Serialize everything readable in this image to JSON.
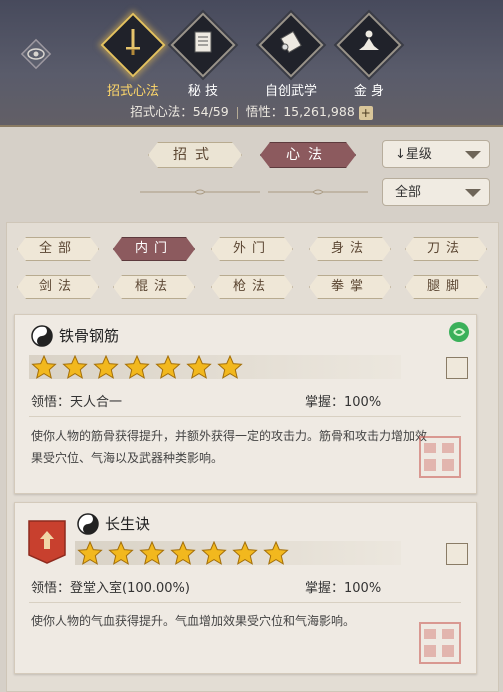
{
  "tabs": [
    {
      "label": "招式心法",
      "icon": "sword-icon",
      "active": true
    },
    {
      "label": "秘 技",
      "icon": "book-icon",
      "active": false
    },
    {
      "label": "自创武学",
      "icon": "scroll-icon",
      "active": false
    },
    {
      "label": "金 身",
      "icon": "meditation-icon",
      "active": false
    }
  ],
  "stats": {
    "skills": "招式心法：54/59",
    "wisdom": "悟性：15,261,988",
    "plus": "+"
  },
  "segments": {
    "moves": "招式",
    "mind": "心法"
  },
  "dropdowns": {
    "sort": "↓星级",
    "filter": "全部"
  },
  "categories": [
    "全部",
    "内门",
    "外门",
    "身法",
    "刀法",
    "剑法",
    "棍法",
    "枪法",
    "拳掌",
    "腿脚"
  ],
  "skills": [
    {
      "name": "铁骨钢筋",
      "stars": 7,
      "insight": "领悟：天人合一",
      "mastery": "掌握：100%",
      "desc": "使你人物的筋骨获得提升，并额外获得一定的攻击力。筋骨和攻击力增加效果受穴位、气海以及武器种类影响。"
    },
    {
      "name": "长生诀",
      "stars": 7,
      "insight": "领悟：登堂入室(100.00%)",
      "mastery": "掌握：100%",
      "desc": "使你人物的气血获得提升。气血增加效果受穴位和气海影响。"
    }
  ],
  "colors": {
    "accent": "#ffd86a",
    "active_pill": "#8c5a5e",
    "star": "#f2b81e"
  }
}
